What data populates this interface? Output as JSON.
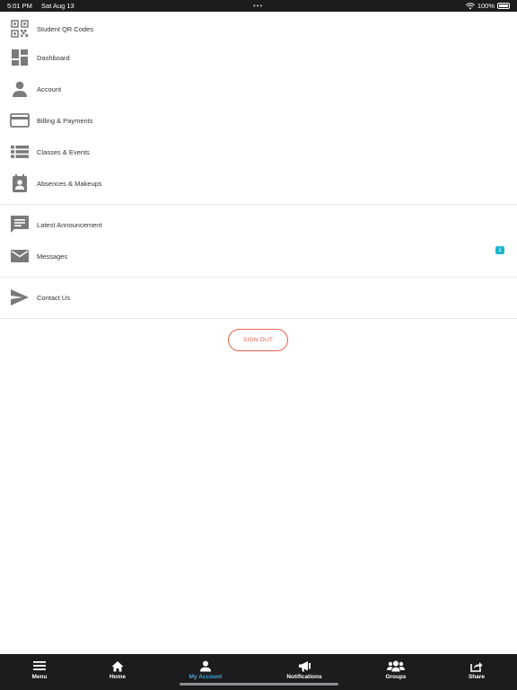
{
  "status": {
    "time": "5:01 PM",
    "date": "Sat Aug 13",
    "battery": "100%"
  },
  "menu": [
    {
      "label": "Student QR Codes",
      "icon": "qr-code-icon"
    },
    {
      "label": "Dashboard",
      "icon": "dashboard-icon"
    },
    {
      "label": "Account",
      "icon": "person-icon"
    },
    {
      "label": "Billing & Payments",
      "icon": "credit-card-icon"
    },
    {
      "label": "Classes & Events",
      "icon": "list-icon"
    },
    {
      "label": "Absences & Makeups",
      "icon": "calendar-person-icon"
    },
    {
      "label": "Latest Announcement",
      "icon": "message-icon"
    },
    {
      "label": "Messages",
      "icon": "mail-icon",
      "badge": "1"
    },
    {
      "label": "Contact Us",
      "icon": "send-icon"
    }
  ],
  "signout_label": "SIGN OUT",
  "tabs": [
    {
      "label": "Menu",
      "icon": "hamburger-icon"
    },
    {
      "label": "Home",
      "icon": "home-icon"
    },
    {
      "label": "My Account",
      "icon": "account-icon",
      "active": true
    },
    {
      "label": "Notifications",
      "icon": "megaphone-icon"
    },
    {
      "label": "Groups",
      "icon": "groups-icon"
    },
    {
      "label": "Share",
      "icon": "share-icon"
    }
  ],
  "colors": {
    "accent": "#3fa7e0",
    "signout": "#e8604c",
    "badge": "#1fb5cc",
    "icon": "#7a7a7a"
  }
}
